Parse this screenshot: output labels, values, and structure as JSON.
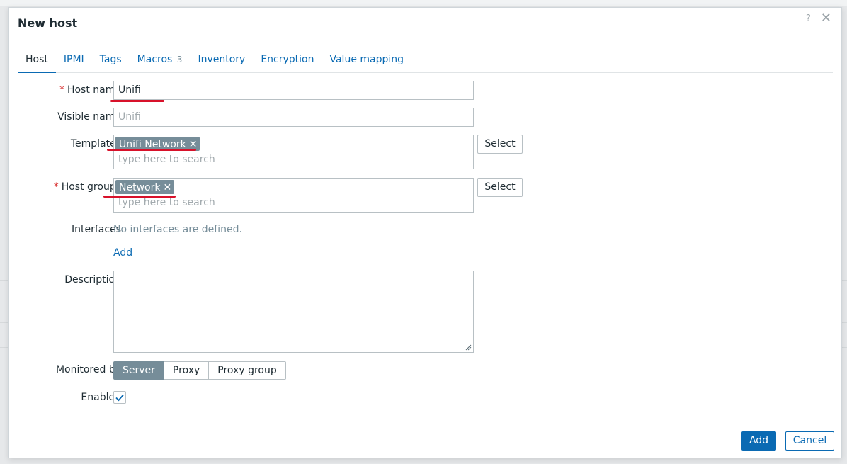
{
  "dialog": {
    "title": "New host",
    "help_label": "?",
    "close_label": "✕"
  },
  "tabs": [
    {
      "label": "Host",
      "count": ""
    },
    {
      "label": "IPMI",
      "count": ""
    },
    {
      "label": "Tags",
      "count": ""
    },
    {
      "label": "Macros",
      "count": "3"
    },
    {
      "label": "Inventory",
      "count": ""
    },
    {
      "label": "Encryption",
      "count": ""
    },
    {
      "label": "Value mapping",
      "count": ""
    }
  ],
  "active_tab": "Host",
  "form": {
    "host_name": {
      "label": "Host name",
      "value": "Unifi",
      "required_mark": "*"
    },
    "visible_name": {
      "label": "Visible name",
      "placeholder": "Unifi"
    },
    "templates": {
      "label": "Templates",
      "chips": [
        "Unifi Network"
      ],
      "search_placeholder": "type here to search",
      "select_label": "Select"
    },
    "host_groups": {
      "label": "Host groups",
      "required_mark": "*",
      "chips": [
        "Network"
      ],
      "search_placeholder": "type here to search",
      "select_label": "Select"
    },
    "interfaces": {
      "label": "Interfaces",
      "empty_text": "No interfaces are defined.",
      "add_label": "Add"
    },
    "description": {
      "label": "Description",
      "value": ""
    },
    "monitored_by": {
      "label": "Monitored by",
      "options": [
        "Server",
        "Proxy",
        "Proxy group"
      ],
      "selected": "Server"
    },
    "enabled": {
      "label": "Enabled",
      "checked": true
    }
  },
  "footer": {
    "add_label": "Add",
    "cancel_label": "Cancel"
  },
  "colors": {
    "accent": "#0a6ab3",
    "chip": "#768d99",
    "required": "#d72e2e",
    "annotation_underline": "#d8112a"
  }
}
